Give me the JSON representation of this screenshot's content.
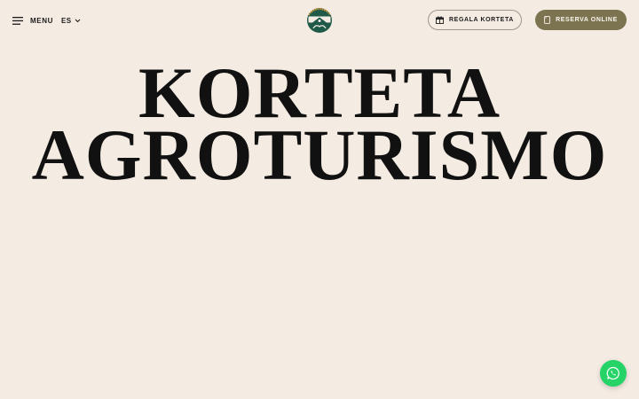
{
  "header": {
    "menu_label": "MENU",
    "language_label": "ES",
    "gift_label": "REGALA KORTETA",
    "reserve_label": "RESERVA ONLINE"
  },
  "hero": {
    "line1": "KORTETA",
    "line2": "AGROTURISMO"
  },
  "icons": {
    "menu": "hamburger-icon",
    "language": "chevron-down-icon",
    "gift": "gift-icon",
    "reserve": "bookmark-icon",
    "logo": "korteta-logo",
    "whatsapp": "whatsapp-icon"
  },
  "colors": {
    "background": "#f4ebe2",
    "reserve_button": "#7c7350",
    "logo_green": "#1f5a48",
    "whatsapp": "#25d366"
  }
}
